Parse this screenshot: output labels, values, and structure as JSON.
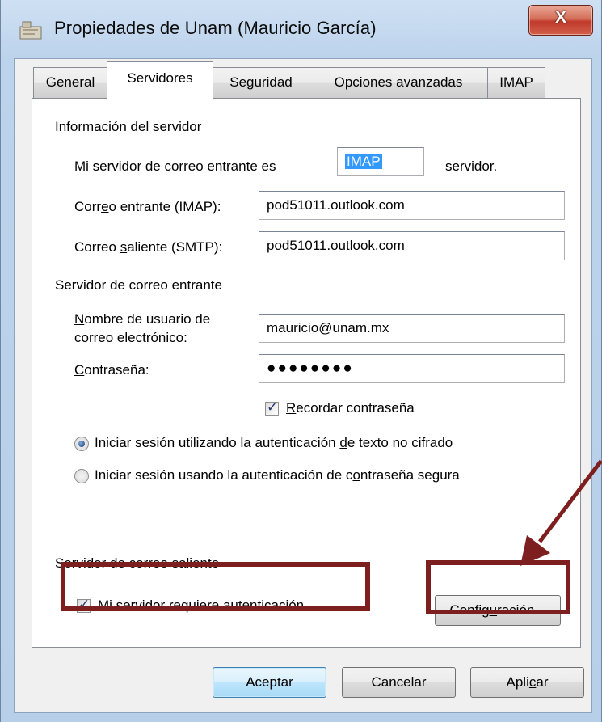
{
  "window": {
    "title": "Propiedades de Unam (Mauricio García)",
    "close_label": "X"
  },
  "tabs": [
    {
      "label": "General"
    },
    {
      "label": "Servidores"
    },
    {
      "label": "Seguridad"
    },
    {
      "label": "Opciones avanzadas"
    },
    {
      "label": "IMAP"
    }
  ],
  "server_info": {
    "group_label": "Información del servidor",
    "incoming_type_prefix": "Mi servidor de correo entrante es",
    "incoming_type_value": "IMAP",
    "incoming_type_suffix": "servidor.",
    "incoming_label": "Correo entrante (IMAP):",
    "incoming_value": "pod51011.outlook.com",
    "outgoing_label": "Correo saliente (SMTP):",
    "outgoing_value": "pod51011.outlook.com"
  },
  "incoming_server": {
    "group_label": "Servidor de correo entrante",
    "username_label_line1": "Nombre de usuario de",
    "username_label_line2": "correo electrónico:",
    "username_value": "mauricio@unam.mx",
    "password_label": "Contraseña:",
    "password_value": "●●●●●●●●",
    "remember_label": "Recordar contraseña",
    "remember_checked": true,
    "radio_plain_label": "Iniciar sesión utilizando la autenticación de texto no cifrado",
    "radio_plain_selected": true,
    "radio_secure_label": "Iniciar sesión usando la autenticación de contraseña segura",
    "radio_secure_selected": false
  },
  "outgoing_server": {
    "group_label": "Servidor de correo saliente",
    "requires_auth_label": "Mi servidor requiere autenticación",
    "requires_auth_checked": true,
    "settings_button": "Configuración..."
  },
  "footer": {
    "accept_label": "Aceptar",
    "cancel_label": "Cancelar",
    "apply_label": "Aplicar"
  },
  "colors": {
    "annotation": "#7e1f1f",
    "selection": "#3399ff"
  }
}
